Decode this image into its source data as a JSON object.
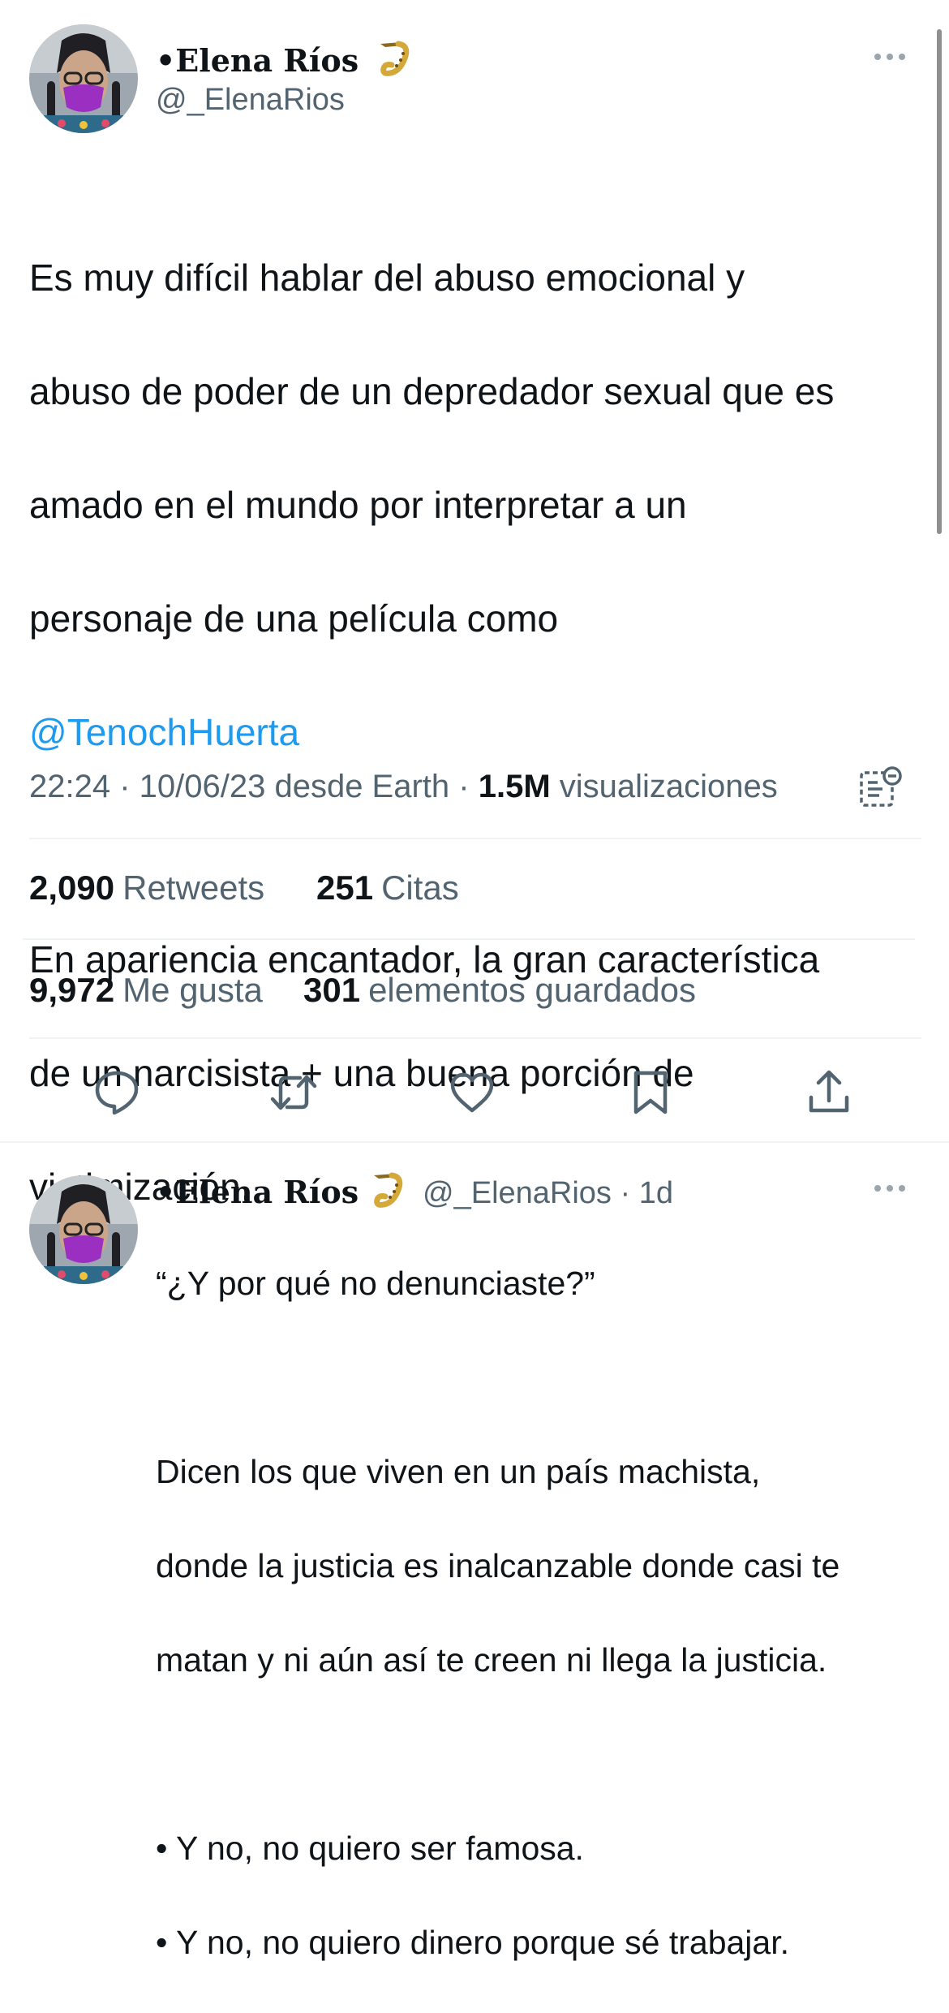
{
  "main_tweet": {
    "author_name": "•Elena Ríos",
    "author_badge": "saxophone-emoji",
    "handle": "@_ElenaRios",
    "text_lines": [
      "Es muy difícil hablar del abuso emocional y",
      "abuso de poder de un depredador sexual que es",
      "amado en el mundo por interpretar a un",
      "personaje de una película como"
    ],
    "mention": "@TenochHuerta",
    "text_lines_2": [
      "En apariencia encantador, la gran característica",
      "de un narcisista + una buena porción de",
      "victimización."
    ],
    "timestamp": "22:24 · 10/06/23 desde Earth · ",
    "views_count": "1.5M",
    "views_label": " visualizaciones",
    "stats": {
      "retweets_count": "2,090",
      "retweets_label": "Retweets",
      "quotes_count": "251",
      "quotes_label": "Citas",
      "likes_count": "9,972",
      "likes_label": "Me gusta",
      "bookmarks_count": "301",
      "bookmarks_label": "elementos guardados"
    },
    "actions": [
      "reply-icon",
      "retweet-icon",
      "like-icon",
      "bookmark-icon",
      "share-icon"
    ]
  },
  "reply_tweet": {
    "author_name": "•Elena Ríos",
    "handle": "@_ElenaRios",
    "age": " · 1d",
    "lines": [
      "“¿Y por qué no denunciaste?”",
      "",
      "Dicen los que viven en un país machista,",
      "donde la justicia es inalcanzable donde casi te",
      "matan y ni aún así te creen ni llega la justicia.",
      "",
      "• Y no, no quiero ser famosa.",
      "• Y no, no quiero dinero porque sé trabajar."
    ]
  },
  "colors": {
    "accent": "#1d9bf0",
    "text": "#0f1419",
    "secondary": "#536471",
    "divider": "#eff3f4",
    "mask": "#9b2fc1"
  }
}
